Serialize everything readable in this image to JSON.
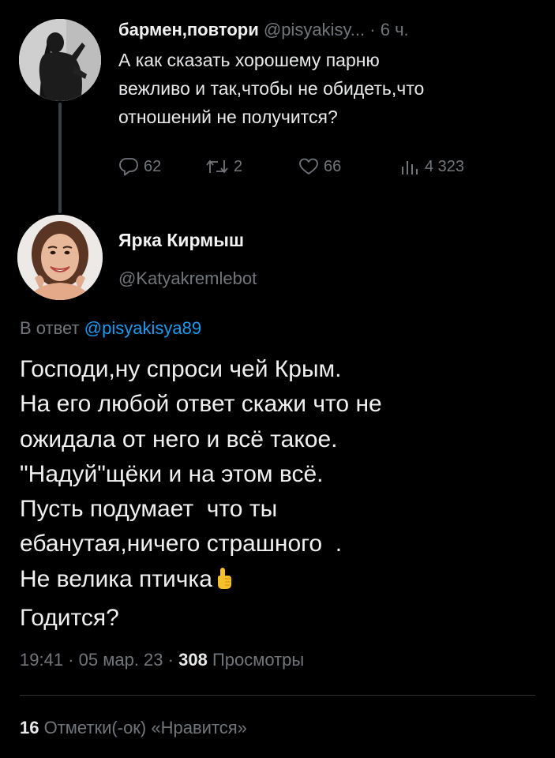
{
  "parent_tweet": {
    "author_name": "бармен,повтори",
    "author_handle": "@pisyakisy...",
    "dot": "·",
    "time": "6 ч.",
    "text_lines": [
      "А как сказать хорошему парню",
      "вежливо и так,чтобы не обидеть,что",
      "отношений не получится?"
    ],
    "actions": {
      "replies": "62",
      "retweets": "2",
      "likes": "66",
      "views": "4 323"
    }
  },
  "main_tweet": {
    "author_name": "Ярка Кирмыш",
    "author_handle": "@Katyakremlebot",
    "reply_prefix": "В ответ",
    "reply_mention": "@pisyakisya89",
    "text_lines": [
      "Господи,ну спроси чей Крым.",
      "На его любой ответ скажи что не",
      "ожидала от него и всё такое.",
      "\"Надуй\"щёки и на этом всё.",
      "Пусть подумает  что ты",
      "ебанутая,ничего страшного  .",
      "Не велика птичка",
      "Годится?"
    ],
    "meta": {
      "time": "19:41",
      "sep": "·",
      "date": "05 мар. 23",
      "views_count": "308",
      "views_label": "Просмотры"
    },
    "likes": {
      "count": "16",
      "label": "Отметки(-ок) «Нравится»"
    }
  },
  "colors": {
    "background": "#000000",
    "text_primary": "#e7e9ea",
    "text_secondary": "#71767b",
    "link": "#1d9bf0",
    "divider": "#2f3336"
  },
  "icons": [
    "reply-icon",
    "retweet-icon",
    "like-icon",
    "views-icon",
    "pointing-up-emoji"
  ]
}
